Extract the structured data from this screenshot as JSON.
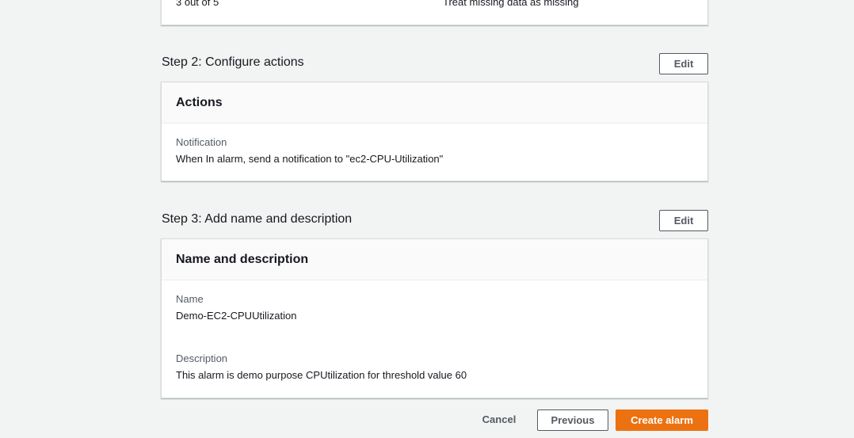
{
  "step1_tail": {
    "datapoints_value": "3 out of 5",
    "missing_data_value": "Treat missing data as missing"
  },
  "step2": {
    "title": "Step 2: Configure actions",
    "edit_label": "Edit",
    "card_title": "Actions",
    "notification_label": "Notification",
    "notification_value": "When In alarm, send a notification to \"ec2-CPU-Utilization\""
  },
  "step3": {
    "title": "Step 3: Add name and description",
    "edit_label": "Edit",
    "card_title": "Name and description",
    "name_label": "Name",
    "name_value": "Demo-EC2-CPUUtilization",
    "description_label": "Description",
    "description_value": "This alarm is demo purpose CPUtilization for threshold value 60"
  },
  "footer": {
    "cancel_label": "Cancel",
    "previous_label": "Previous",
    "create_label": "Create alarm"
  },
  "colors": {
    "primary_button": "#ec7211",
    "page_background": "#f2f3f3"
  }
}
